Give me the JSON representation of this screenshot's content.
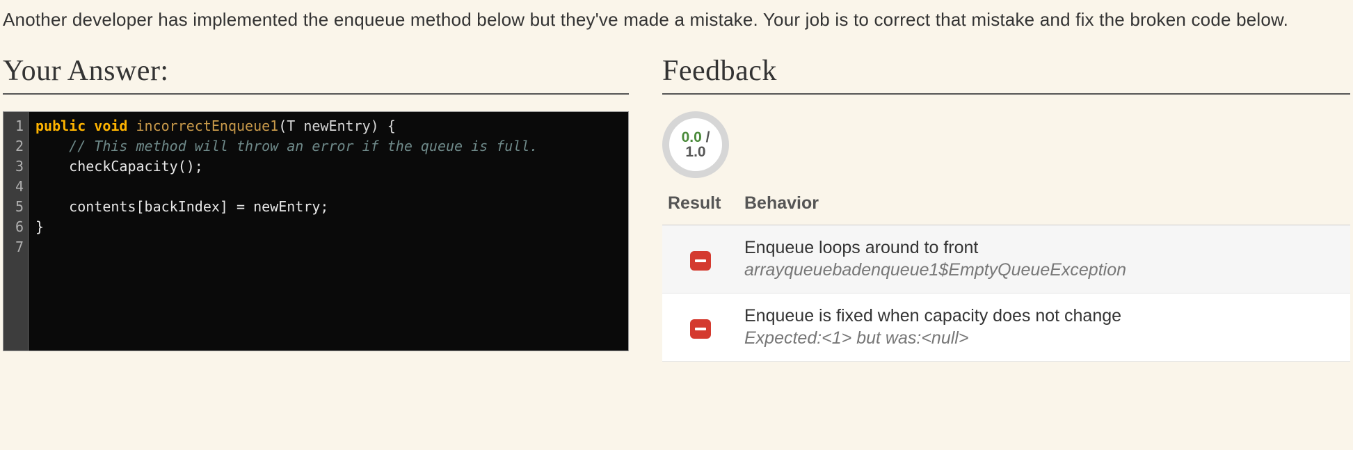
{
  "prompt": "Another developer has implemented the enqueue method below but they've made a mistake. Your job is to correct that mistake and fix the broken code below.",
  "answer": {
    "heading": "Your Answer:",
    "gutter": [
      "1",
      "2",
      "3",
      "4",
      "5",
      "6",
      "7"
    ],
    "code": {
      "l1_kw1": "public",
      "l1_kw2": "void",
      "l1_fn": "incorrectEnqueue1",
      "l1_sig_open": "(",
      "l1_ty": "T",
      "l1_arg": " newEntry) {",
      "l2_cm": "// This method will throw an error if the queue is full.",
      "l3": "checkCapacity();",
      "l5": "contents[backIndex] = newEntry;",
      "l6": "}"
    }
  },
  "feedback": {
    "heading": "Feedback",
    "score_earned": "0.0",
    "score_sep": " / ",
    "score_total": "1.0",
    "cols": {
      "result": "Result",
      "behavior": "Behavior"
    },
    "rows": [
      {
        "status": "fail",
        "title": "Enqueue loops around to front",
        "detail": "arrayqueuebadenqueue1$EmptyQueueException"
      },
      {
        "status": "fail",
        "title": "Enqueue is fixed when capacity does not change",
        "detail": "Expected:<1> but was:<null>"
      }
    ]
  }
}
